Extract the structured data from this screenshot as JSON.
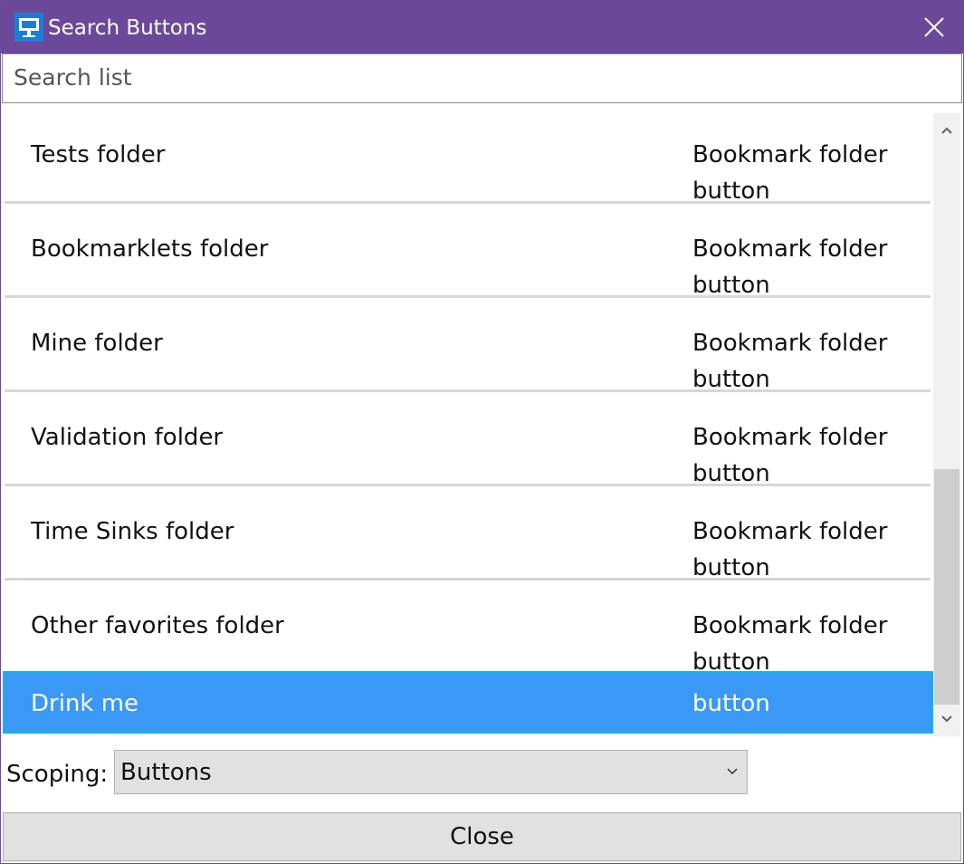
{
  "window": {
    "title": "Search Buttons",
    "title_bar_color": "#6c489a"
  },
  "search": {
    "placeholder": "Search list",
    "value": ""
  },
  "list": {
    "items": [
      {
        "name": "Tests folder",
        "type": "Bookmark folder button"
      },
      {
        "name": "Bookmarklets folder",
        "type": "Bookmark folder button"
      },
      {
        "name": "Mine folder",
        "type": "Bookmark folder button"
      },
      {
        "name": "Validation folder",
        "type": "Bookmark folder button"
      },
      {
        "name": "Time Sinks folder",
        "type": "Bookmark folder button"
      },
      {
        "name": "Other favorites folder",
        "type": "Bookmark folder button"
      },
      {
        "name": "Drink me",
        "type": "button",
        "selected": true
      }
    ],
    "selection_color": "#3a98f6"
  },
  "scoping": {
    "label": "Scoping:",
    "selected": "Buttons"
  },
  "footer": {
    "close_label": "Close"
  },
  "icons": {
    "app": "app-icon",
    "close": "close-icon",
    "scroll_up": "chevron-up-icon",
    "scroll_down": "chevron-down-icon",
    "dropdown": "chevron-down-icon"
  }
}
